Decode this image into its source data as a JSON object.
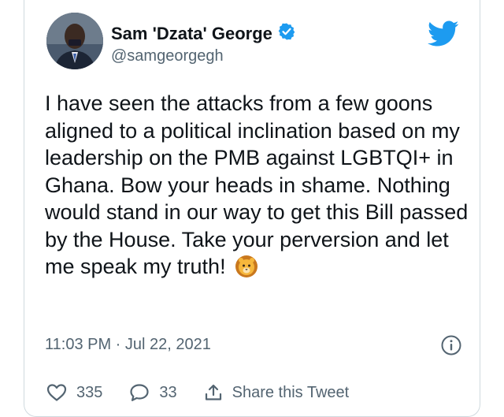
{
  "user": {
    "display_name": "Sam 'Dzata' George",
    "handle": "@samgeorgegh",
    "verified": true
  },
  "tweet": {
    "text": "I have seen the attacks from a few goons aligned to a political inclination based on my leadership on the PMB against LGBTQI+ in Ghana. Bow your heads in shame. Nothing would stand in our way to get this Bill passed by the House. Take your perversion and let me speak my truth!",
    "emoji": "lion-face",
    "timestamp": "11:03 PM · Jul 22, 2021"
  },
  "actions": {
    "likes": "335",
    "replies": "33",
    "share_label": "Share this Tweet"
  },
  "colors": {
    "twitter_blue": "#1d9bf0",
    "text_primary": "#0f1419",
    "text_secondary": "#536471",
    "border": "#cfd9de"
  },
  "icons": [
    "verified-badge-icon",
    "twitter-bird-icon",
    "info-icon",
    "heart-icon",
    "reply-icon",
    "share-icon",
    "lion-emoji"
  ]
}
